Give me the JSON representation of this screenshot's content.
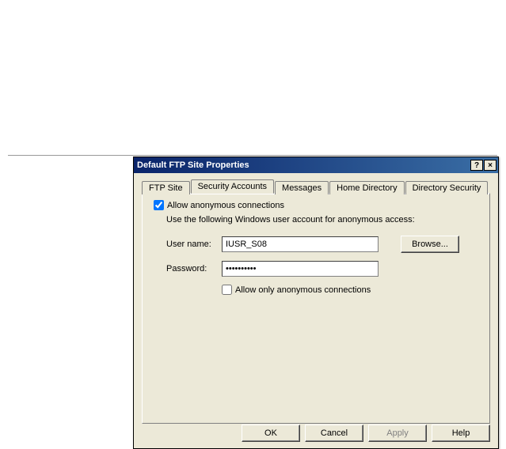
{
  "dialog": {
    "title": "Default FTP Site Properties",
    "helpGlyph": "?",
    "closeGlyph": "×"
  },
  "tabs": {
    "items": [
      {
        "label": "FTP Site"
      },
      {
        "label": "Security Accounts"
      },
      {
        "label": "Messages"
      },
      {
        "label": "Home Directory"
      },
      {
        "label": "Directory Security"
      }
    ]
  },
  "panel": {
    "allowAnonLabel": "Allow anonymous connections",
    "allowAnonChecked": true,
    "subtitle": "Use the following Windows user account for anonymous access:",
    "usernameLabel": "User name:",
    "usernameValue": "IUSR_S08",
    "passwordLabel": "Password:",
    "passwordValue": "••••••••••",
    "browseLabel": "Browse...",
    "allowOnlyLabel": "Allow only anonymous connections",
    "allowOnlyChecked": false
  },
  "buttons": {
    "ok": "OK",
    "cancel": "Cancel",
    "apply": "Apply",
    "help": "Help"
  }
}
